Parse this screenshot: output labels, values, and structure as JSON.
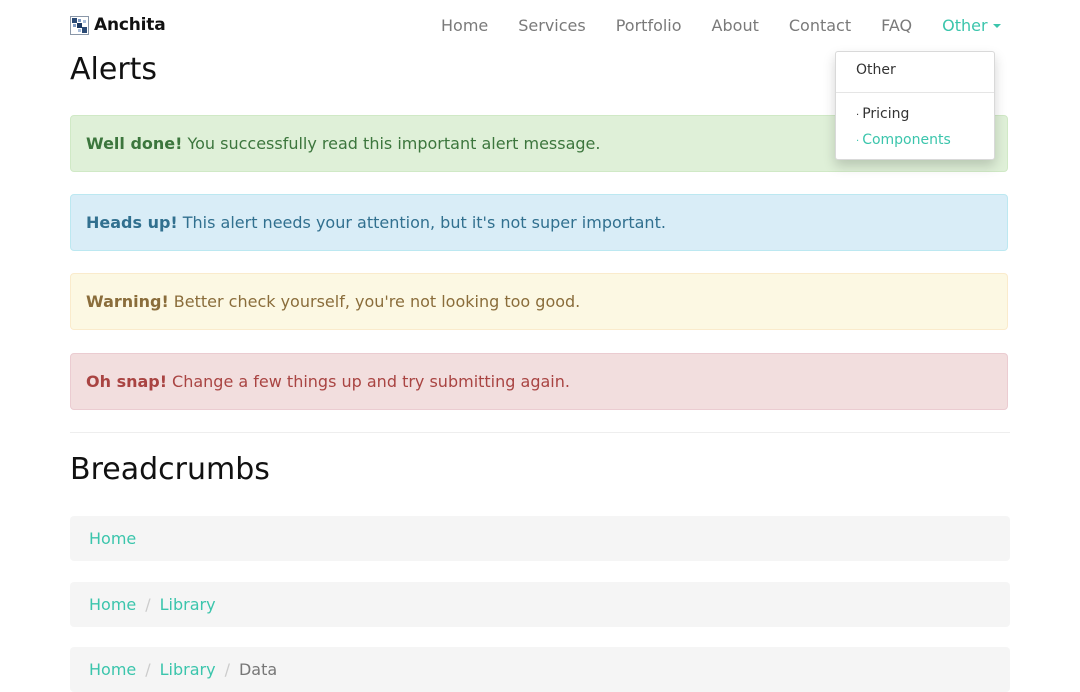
{
  "brand": {
    "name": "Anchita"
  },
  "nav": {
    "items": [
      {
        "label": "Home"
      },
      {
        "label": "Services"
      },
      {
        "label": "Portfolio"
      },
      {
        "label": "About"
      },
      {
        "label": "Contact"
      },
      {
        "label": "FAQ"
      },
      {
        "label": "Other"
      }
    ],
    "active_item": "Other"
  },
  "dropdown": {
    "header": "Other",
    "items": [
      {
        "bullet": "·",
        "label": "Pricing"
      },
      {
        "bullet": "·",
        "label": "Components"
      }
    ]
  },
  "alerts_section": {
    "title": "Alerts",
    "alerts": [
      {
        "strong": "Well done!",
        "text": "You successfully read this important alert message."
      },
      {
        "strong": "Heads up!",
        "text": "This alert needs your attention, but it's not super important."
      },
      {
        "strong": "Warning!",
        "text": "Better check yourself, you're not looking too good."
      },
      {
        "strong": "Oh snap!",
        "text": "Change a few things up and try submitting again."
      }
    ]
  },
  "breadcrumbs_section": {
    "title": "Breadcrumbs",
    "separator": "/",
    "crumb_1": {
      "home": "Home"
    },
    "crumb_2": {
      "home": "Home",
      "library": "Library"
    },
    "crumb_3": {
      "home": "Home",
      "library": "Library",
      "current": "Data"
    }
  },
  "colors": {
    "accent": "#3bc5ac",
    "nav_text": "#7a7a7a",
    "success_bg": "#dff0d8",
    "info_bg": "#d9edf7",
    "warning_bg": "#fcf8e3",
    "danger_bg": "#f2dede",
    "breadcrumb_bg": "#f5f5f5"
  }
}
